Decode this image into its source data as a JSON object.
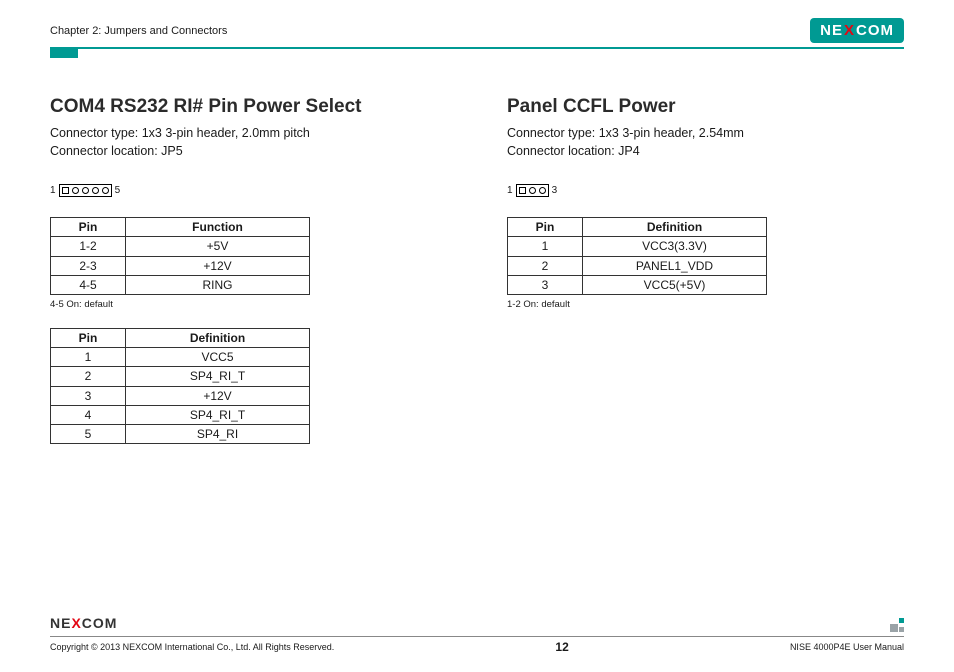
{
  "brand": {
    "part1": "NE",
    "x": "X",
    "part2": "COM"
  },
  "header": {
    "chapter": "Chapter 2: Jumpers and Connectors"
  },
  "left": {
    "title": "COM4 RS232 RI# Pin Power Select",
    "desc1": "Connector type: 1x3 3-pin header, 2.0mm pitch",
    "desc2": "Connector location: JP5",
    "jumper_left": "1",
    "jumper_right": "5",
    "jumper_pins": 5,
    "func_table": {
      "headers": [
        "Pin",
        "Function"
      ],
      "rows": [
        [
          "1-2",
          "+5V"
        ],
        [
          "2-3",
          "+12V"
        ],
        [
          "4-5",
          "RING"
        ]
      ]
    },
    "func_note": "4-5 On: default",
    "def_table": {
      "headers": [
        "Pin",
        "Definition"
      ],
      "rows": [
        [
          "1",
          "VCC5"
        ],
        [
          "2",
          "SP4_RI_T"
        ],
        [
          "3",
          "+12V"
        ],
        [
          "4",
          "SP4_RI_T"
        ],
        [
          "5",
          "SP4_RI"
        ]
      ]
    }
  },
  "right": {
    "title": "Panel CCFL Power",
    "desc1": "Connector type: 1x3 3-pin header, 2.54mm",
    "desc2": "Connector location: JP4",
    "jumper_left": "1",
    "jumper_right": "3",
    "jumper_pins": 3,
    "def_table": {
      "headers": [
        "Pin",
        "Definition"
      ],
      "rows": [
        [
          "1",
          "VCC3(3.3V)"
        ],
        [
          "2",
          "PANEL1_VDD"
        ],
        [
          "3",
          "VCC5(+5V)"
        ]
      ]
    },
    "def_note": "1-2 On: default"
  },
  "footer": {
    "copyright": "Copyright © 2013 NEXCOM International Co., Ltd. All Rights Reserved.",
    "page": "12",
    "manual": "NISE 4000P4E User Manual"
  }
}
